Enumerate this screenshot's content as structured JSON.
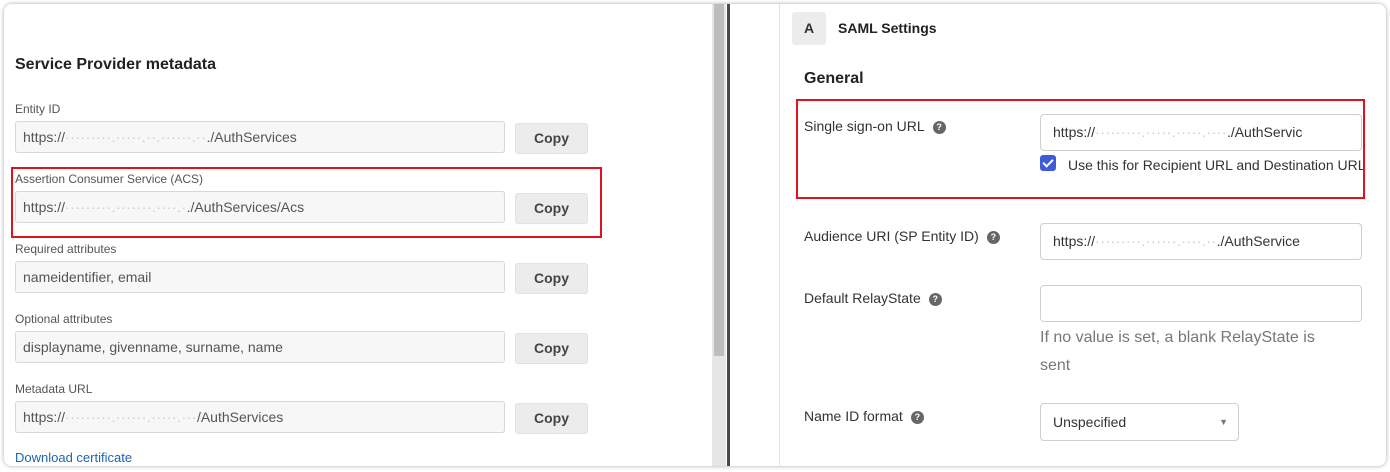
{
  "left_panel": {
    "title": "Service Provider metadata",
    "fields": [
      {
        "label": "Entity ID",
        "value_prefix": "https://",
        "value_blurred": "·········.·····.··.······.··",
        "value_suffix": "./AuthServices",
        "copy_label": "Copy"
      },
      {
        "label": "Assertion Consumer Service (ACS)",
        "value_prefix": "https://",
        "value_blurred": "·········.·······.····.·",
        "value_suffix": "./AuthServices/Acs",
        "copy_label": "Copy"
      },
      {
        "label": "Required attributes",
        "value_prefix": "nameidentifier, email",
        "value_blurred": "",
        "value_suffix": "",
        "copy_label": "Copy"
      },
      {
        "label": "Optional attributes",
        "value_prefix": "displayname, givenname, surname, name",
        "value_blurred": "",
        "value_suffix": "",
        "copy_label": "Copy"
      },
      {
        "label": "Metadata URL",
        "value_prefix": "https://",
        "value_blurred": "·········.······.·····.···",
        "value_suffix": "/AuthServices",
        "copy_label": "Copy"
      }
    ],
    "download_link": "Download certificate"
  },
  "right_panel": {
    "step_badge": "A",
    "step_title": "SAML Settings",
    "section_title": "General",
    "help_glyph": "?",
    "sso": {
      "label": "Single sign-on URL",
      "value_prefix": "https://",
      "value_blurred": "·········.·····.·····.····",
      "value_suffix": "./AuthServic",
      "checkbox_label": "Use this for Recipient URL and Destination URL",
      "checked": true
    },
    "audience": {
      "label": "Audience URI (SP Entity ID)",
      "value_prefix": "https://",
      "value_blurred": "·········.······.····.··",
      "value_suffix": "./AuthService"
    },
    "relay_state": {
      "label": "Default RelayState",
      "value": "",
      "hint": "If no value is set, a blank RelayState is sent"
    },
    "name_id": {
      "label": "Name ID format",
      "selected": "Unspecified",
      "caret": "▼"
    }
  },
  "colors": {
    "highlight": "#e0121b",
    "checkbox": "#3f5bd8",
    "link": "#1a66b3"
  }
}
